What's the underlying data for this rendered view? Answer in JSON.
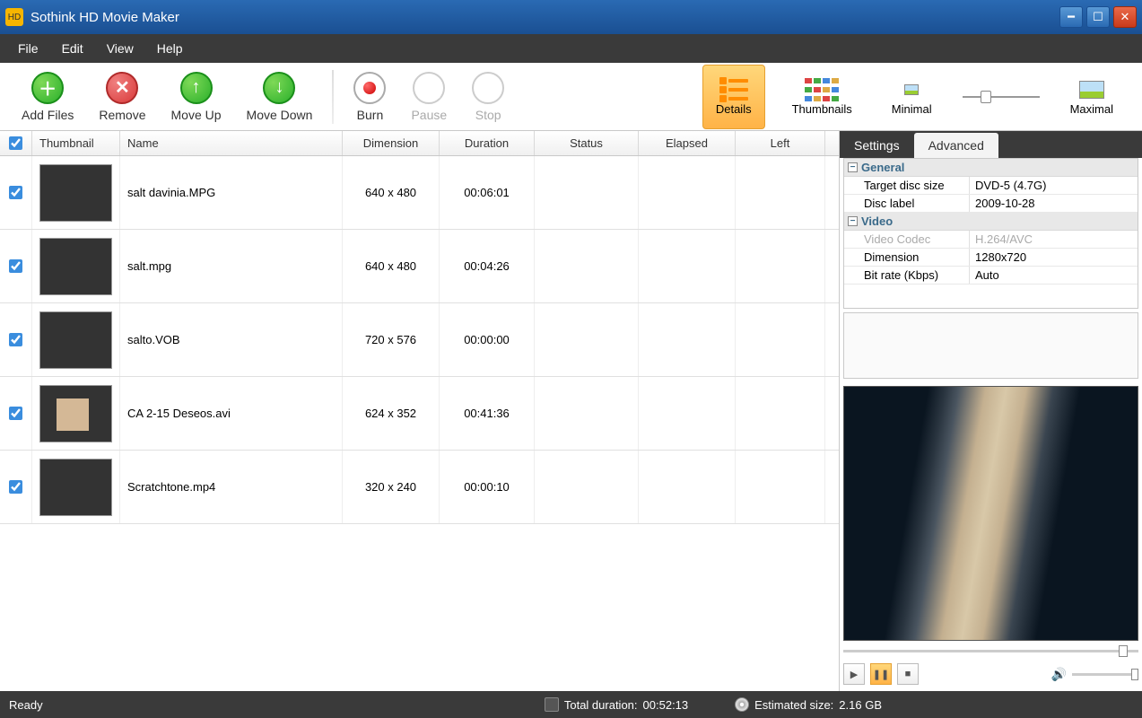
{
  "title": "Sothink HD Movie Maker",
  "menu": [
    "File",
    "Edit",
    "View",
    "Help"
  ],
  "toolbar": {
    "add_files": "Add Files",
    "remove": "Remove",
    "move_up": "Move Up",
    "move_down": "Move Down",
    "burn": "Burn",
    "pause": "Pause",
    "stop": "Stop",
    "details": "Details",
    "thumbnails": "Thumbnails",
    "minimal": "Minimal",
    "maximal": "Maximal"
  },
  "columns": {
    "thumbnail": "Thumbnail",
    "name": "Name",
    "dimension": "Dimension",
    "duration": "Duration",
    "status": "Status",
    "elapsed": "Elapsed",
    "left": "Left"
  },
  "files": [
    {
      "checked": true,
      "name": "salt davinia.MPG",
      "dimension": "640 x 480",
      "duration": "00:06:01"
    },
    {
      "checked": true,
      "name": "salt.mpg",
      "dimension": "640 x 480",
      "duration": "00:04:26"
    },
    {
      "checked": true,
      "name": "salto.VOB",
      "dimension": "720 x 576",
      "duration": "00:00:00"
    },
    {
      "checked": true,
      "name": "CA 2-15 Deseos.avi",
      "dimension": "624 x 352",
      "duration": "00:41:36"
    },
    {
      "checked": true,
      "name": "Scratchtone.mp4",
      "dimension": "320 x 240",
      "duration": "00:00:10"
    }
  ],
  "side": {
    "tabs": {
      "settings": "Settings",
      "advanced": "Advanced"
    },
    "groups": {
      "general": "General",
      "video": "Video"
    },
    "props": {
      "target_disc_size": {
        "name": "Target disc size",
        "value": "DVD-5 (4.7G)"
      },
      "disc_label": {
        "name": "Disc label",
        "value": "2009-10-28"
      },
      "video_codec": {
        "name": "Video Codec",
        "value": "H.264/AVC"
      },
      "dimension": {
        "name": "Dimension",
        "value": "1280x720"
      },
      "bit_rate": {
        "name": "Bit rate (Kbps)",
        "value": "Auto"
      }
    }
  },
  "status": {
    "ready": "Ready",
    "total_duration_label": "Total duration:",
    "total_duration": "00:52:13",
    "estimated_size_label": "Estimated size:",
    "estimated_size": "2.16 GB"
  }
}
